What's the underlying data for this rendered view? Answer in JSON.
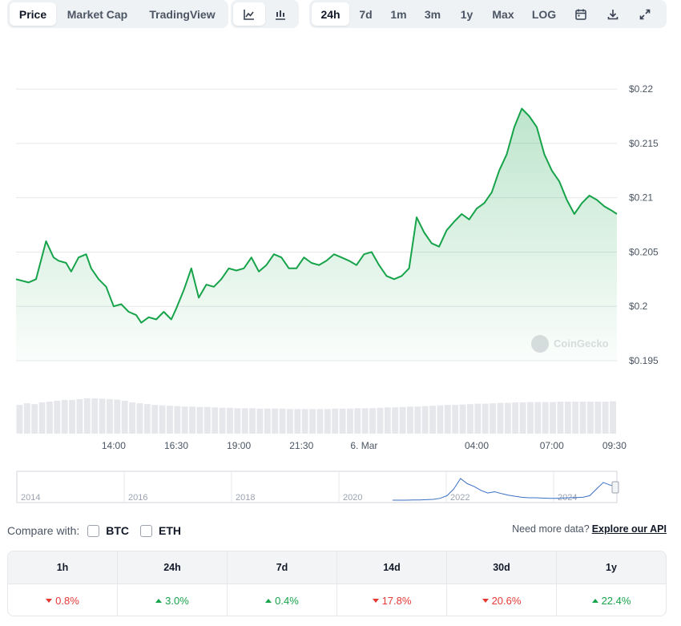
{
  "toolbar": {
    "tabs": [
      {
        "label": "Price",
        "active": true
      },
      {
        "label": "Market Cap",
        "active": false
      },
      {
        "label": "TradingView",
        "active": false
      }
    ],
    "chart_types": [
      {
        "icon": "line-chart-icon",
        "active": true
      },
      {
        "icon": "candlestick-chart-icon",
        "active": false
      }
    ],
    "ranges": [
      {
        "label": "24h",
        "active": true
      },
      {
        "label": "7d",
        "active": false
      },
      {
        "label": "1m",
        "active": false
      },
      {
        "label": "3m",
        "active": false
      },
      {
        "label": "1y",
        "active": false
      },
      {
        "label": "Max",
        "active": false
      },
      {
        "label": "LOG",
        "active": false
      }
    ],
    "tools": [
      "calendar-icon",
      "download-icon",
      "expand-icon"
    ]
  },
  "chart_data": {
    "type": "area",
    "color": "#16a34a",
    "ylim": [
      0.195,
      0.222
    ],
    "y_ticks": [
      "$0.22",
      "$0.215",
      "$0.21",
      "$0.205",
      "$0.2",
      "$0.195"
    ],
    "y_tick_values": [
      0.22,
      0.215,
      0.21,
      0.205,
      0.2,
      0.195
    ],
    "x_ticks": [
      "14:00",
      "16:30",
      "19:00",
      "21:30",
      "6. Mar",
      "04:00",
      "07:00",
      "09:30"
    ],
    "x_tick_hours": [
      3.9,
      6.4,
      8.9,
      11.4,
      13.9,
      18.4,
      21.4,
      23.9
    ],
    "series": [
      {
        "x": [
          0.0,
          0.5,
          0.8,
          1.2,
          1.5,
          1.7,
          2.0,
          2.2,
          2.5,
          2.8,
          3.0,
          3.3,
          3.6,
          3.9,
          4.2,
          4.5,
          4.8,
          5.0,
          5.3,
          5.6,
          5.9,
          6.2,
          6.4,
          6.7,
          7.0,
          7.3,
          7.6,
          7.9,
          8.2,
          8.5,
          8.8,
          9.1,
          9.4,
          9.7,
          10.0,
          10.3,
          10.6,
          10.9,
          11.2,
          11.5,
          11.8,
          12.1,
          12.4,
          12.7,
          13.0,
          13.3,
          13.6,
          13.9,
          14.2,
          14.5,
          14.8,
          15.1,
          15.4,
          15.7,
          16.0,
          16.3,
          16.6,
          16.9,
          17.2,
          17.5,
          17.8,
          18.1,
          18.4,
          18.7,
          19.0,
          19.3,
          19.6,
          19.9,
          20.2,
          20.5,
          20.8,
          21.1,
          21.4,
          21.7,
          22.0,
          22.3,
          22.6,
          22.9,
          23.2,
          23.5,
          23.8,
          24.0
        ],
        "y": [
          0.2025,
          0.2022,
          0.2025,
          0.206,
          0.2045,
          0.2042,
          0.204,
          0.2032,
          0.2045,
          0.2048,
          0.2035,
          0.2025,
          0.2018,
          0.2,
          0.2002,
          0.1995,
          0.1992,
          0.1985,
          0.199,
          0.1988,
          0.1995,
          0.1988,
          0.1998,
          0.2015,
          0.2035,
          0.2008,
          0.202,
          0.2018,
          0.2025,
          0.2035,
          0.2033,
          0.2035,
          0.2045,
          0.2032,
          0.2038,
          0.2048,
          0.2045,
          0.2035,
          0.2035,
          0.2045,
          0.204,
          0.2038,
          0.2042,
          0.2048,
          0.2045,
          0.2042,
          0.2038,
          0.2048,
          0.205,
          0.2038,
          0.2028,
          0.2025,
          0.2028,
          0.2035,
          0.2082,
          0.2068,
          0.2058,
          0.2055,
          0.207,
          0.2078,
          0.2085,
          0.208,
          0.209,
          0.2095,
          0.2105,
          0.2125,
          0.214,
          0.2165,
          0.2182,
          0.2175,
          0.2165,
          0.214,
          0.2125,
          0.2115,
          0.2098,
          0.2085,
          0.2095,
          0.2102,
          0.2098,
          0.2092,
          0.2088,
          0.2085
        ]
      }
    ],
    "volume": [
      0.7,
      0.74,
      0.72,
      0.76,
      0.78,
      0.8,
      0.82,
      0.82,
      0.84,
      0.86,
      0.86,
      0.85,
      0.84,
      0.83,
      0.8,
      0.76,
      0.74,
      0.72,
      0.7,
      0.69,
      0.68,
      0.67,
      0.66,
      0.66,
      0.65,
      0.65,
      0.64,
      0.63,
      0.63,
      0.62,
      0.62,
      0.62,
      0.61,
      0.61,
      0.61,
      0.61,
      0.6,
      0.6,
      0.6,
      0.6,
      0.6,
      0.6,
      0.61,
      0.61,
      0.61,
      0.62,
      0.62,
      0.62,
      0.63,
      0.64,
      0.64,
      0.65,
      0.66,
      0.66,
      0.67,
      0.68,
      0.69,
      0.7,
      0.7,
      0.71,
      0.72,
      0.73,
      0.73,
      0.74,
      0.75,
      0.75,
      0.76,
      0.76,
      0.77,
      0.77,
      0.77,
      0.77,
      0.78,
      0.78,
      0.78,
      0.78,
      0.78,
      0.78,
      0.78,
      0.79
    ],
    "watermark": "CoinGecko"
  },
  "navigator": {
    "years": [
      "2014",
      "2016",
      "2018",
      "2020",
      "2022",
      "2024"
    ],
    "history": [
      0.03,
      0.03,
      0.03,
      0.04,
      0.04,
      0.05,
      0.06,
      0.1,
      0.2,
      0.45,
      0.85,
      0.65,
      0.55,
      0.4,
      0.3,
      0.35,
      0.28,
      0.22,
      0.18,
      0.14,
      0.12,
      0.12,
      0.11,
      0.1,
      0.1,
      0.11,
      0.12,
      0.13,
      0.14,
      0.2,
      0.45,
      0.7,
      0.6,
      0.55
    ]
  },
  "compare": {
    "label": "Compare with:",
    "options": [
      "BTC",
      "ETH"
    ]
  },
  "api": {
    "prefix": "Need more data?",
    "link": "Explore our API"
  },
  "performance": {
    "headers": [
      "1h",
      "24h",
      "7d",
      "14d",
      "30d",
      "1y"
    ],
    "values": [
      {
        "text": "0.8%",
        "direction": "down"
      },
      {
        "text": "3.0%",
        "direction": "up"
      },
      {
        "text": "0.4%",
        "direction": "up"
      },
      {
        "text": "17.8%",
        "direction": "down"
      },
      {
        "text": "20.6%",
        "direction": "down"
      },
      {
        "text": "22.4%",
        "direction": "up"
      }
    ]
  }
}
